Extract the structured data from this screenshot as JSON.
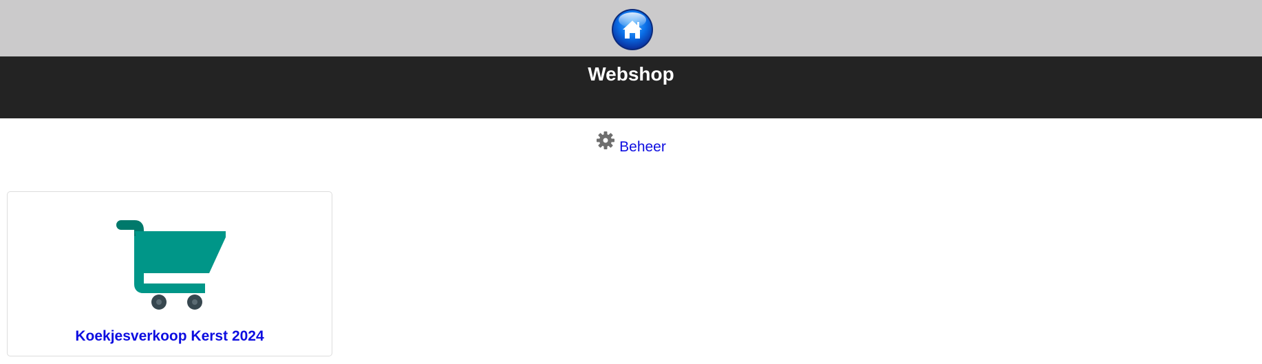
{
  "topbar": {
    "home_icon": "home-icon"
  },
  "header": {
    "title": "Webshop"
  },
  "admin": {
    "label": "Beheer",
    "icon": "gear-icon"
  },
  "shops": [
    {
      "title": "Koekjesverkoop Kerst 2024",
      "icon": "shopping-cart-icon",
      "color": "#009688"
    }
  ]
}
